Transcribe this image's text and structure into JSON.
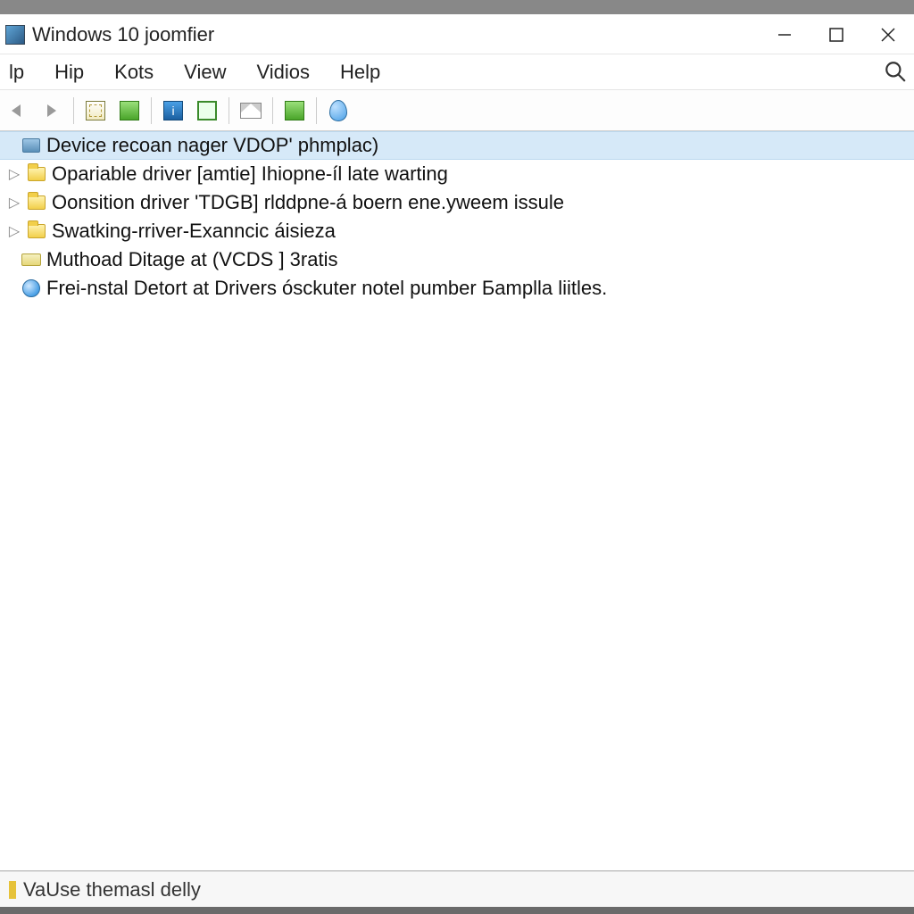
{
  "title": "Windows 10 joomfier",
  "menu": {
    "items": [
      "lp",
      "Hip",
      "Kots",
      "View",
      "Vidios",
      "Help"
    ]
  },
  "toolbar": {
    "buttons": [
      {
        "name": "back-button",
        "icon": "arrow-left"
      },
      {
        "name": "forward-button",
        "icon": "arrow-right"
      },
      {
        "sep": true
      },
      {
        "name": "tool-properties",
        "icon": "box"
      },
      {
        "name": "tool-green",
        "icon": "green"
      },
      {
        "sep": true
      },
      {
        "name": "tool-blue",
        "icon": "blue"
      },
      {
        "name": "tool-green2",
        "icon": "greenline"
      },
      {
        "sep": true
      },
      {
        "name": "tool-mail",
        "icon": "mail"
      },
      {
        "sep": true
      },
      {
        "name": "tool-refresh",
        "icon": "green"
      },
      {
        "sep": true
      },
      {
        "name": "tool-drop",
        "icon": "drop"
      }
    ]
  },
  "tree": [
    {
      "label": "Device recoan nager  VDOP' phmplac)",
      "icon": "pc",
      "selected": true,
      "expandable": false,
      "depth": 0
    },
    {
      "label": "Opariable driver [amtie] Ihiopne-íl late warting",
      "icon": "folder",
      "selected": false,
      "expandable": true,
      "depth": 1
    },
    {
      "label": "Oonsition driver 'TDGB] rlddpne-á boern ene.yweem issule",
      "icon": "folder",
      "selected": false,
      "expandable": true,
      "depth": 1
    },
    {
      "label": "Swatking-rriver-Exanncic áisieza",
      "icon": "folder",
      "selected": false,
      "expandable": true,
      "depth": 1
    },
    {
      "label": "Muthoad Ditage at (VCDS ] 3ratis",
      "icon": "drive",
      "selected": false,
      "expandable": false,
      "depth": 0
    },
    {
      "label": "Frei-nstal Detort at Drivers ósckuter notel pumber Бamplla liitles.",
      "icon": "globe",
      "selected": false,
      "expandable": false,
      "depth": 0
    }
  ],
  "status": {
    "text": "VaUse themasl delly"
  }
}
